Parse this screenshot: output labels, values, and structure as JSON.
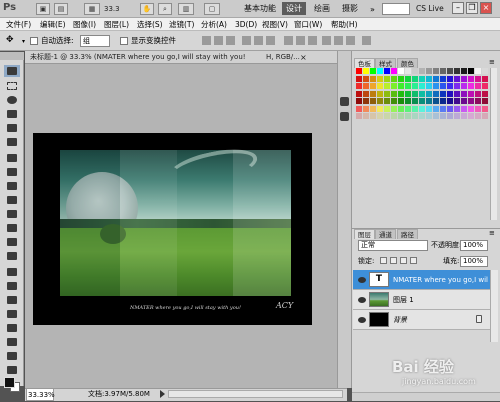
{
  "app": {
    "logo": "Ps",
    "zoom_display": "33.3",
    "workspaces": [
      "基本功能",
      "设计",
      "绘画",
      "摄影"
    ],
    "active_workspace": "设计",
    "cs_live": "CS Live"
  },
  "menu": [
    "文件(F)",
    "编辑(E)",
    "图像(I)",
    "图层(L)",
    "选择(S)",
    "滤镜(T)",
    "分析(A)",
    "3D(D)",
    "视图(V)",
    "窗口(W)",
    "帮助(H)"
  ],
  "options": {
    "auto_select_label": "自动选择:",
    "auto_select_value": "组",
    "show_transform_label": "显示变换控件"
  },
  "document": {
    "tab_title": "未标题-1 @ 33.3% (NMATER where you go,I will stay with you!",
    "tab_mode": "H, RGB/...",
    "close": "×"
  },
  "artwork": {
    "caption": "NMATER where you go,I will stay with you!",
    "signature": "ACY"
  },
  "status": {
    "zoom": "33.33%",
    "doc_info": "文档:3.97M/5.80M"
  },
  "panels": {
    "swatch_tabs": [
      "色板",
      "样式",
      "颜色"
    ],
    "layer_tabs": [
      "图层",
      "通道",
      "路径"
    ],
    "blend_mode": "正常",
    "opacity_label": "不透明度:",
    "opacity_value": "100%",
    "lock_label": "锁定:",
    "fill_label": "填充:",
    "fill_value": "100%",
    "layers": [
      {
        "name": "NMATER where you go,I will ...",
        "type": "text",
        "selected": true
      },
      {
        "name": "图层 1",
        "type": "image",
        "selected": false
      },
      {
        "name": "背景",
        "type": "background",
        "selected": false
      }
    ]
  },
  "watermark": {
    "text": "Bai 经验",
    "sub": "jingyan.baidu.com"
  },
  "colors": {
    "accent": "#3e8fd8",
    "workspace_active": "#5c5c5c"
  }
}
